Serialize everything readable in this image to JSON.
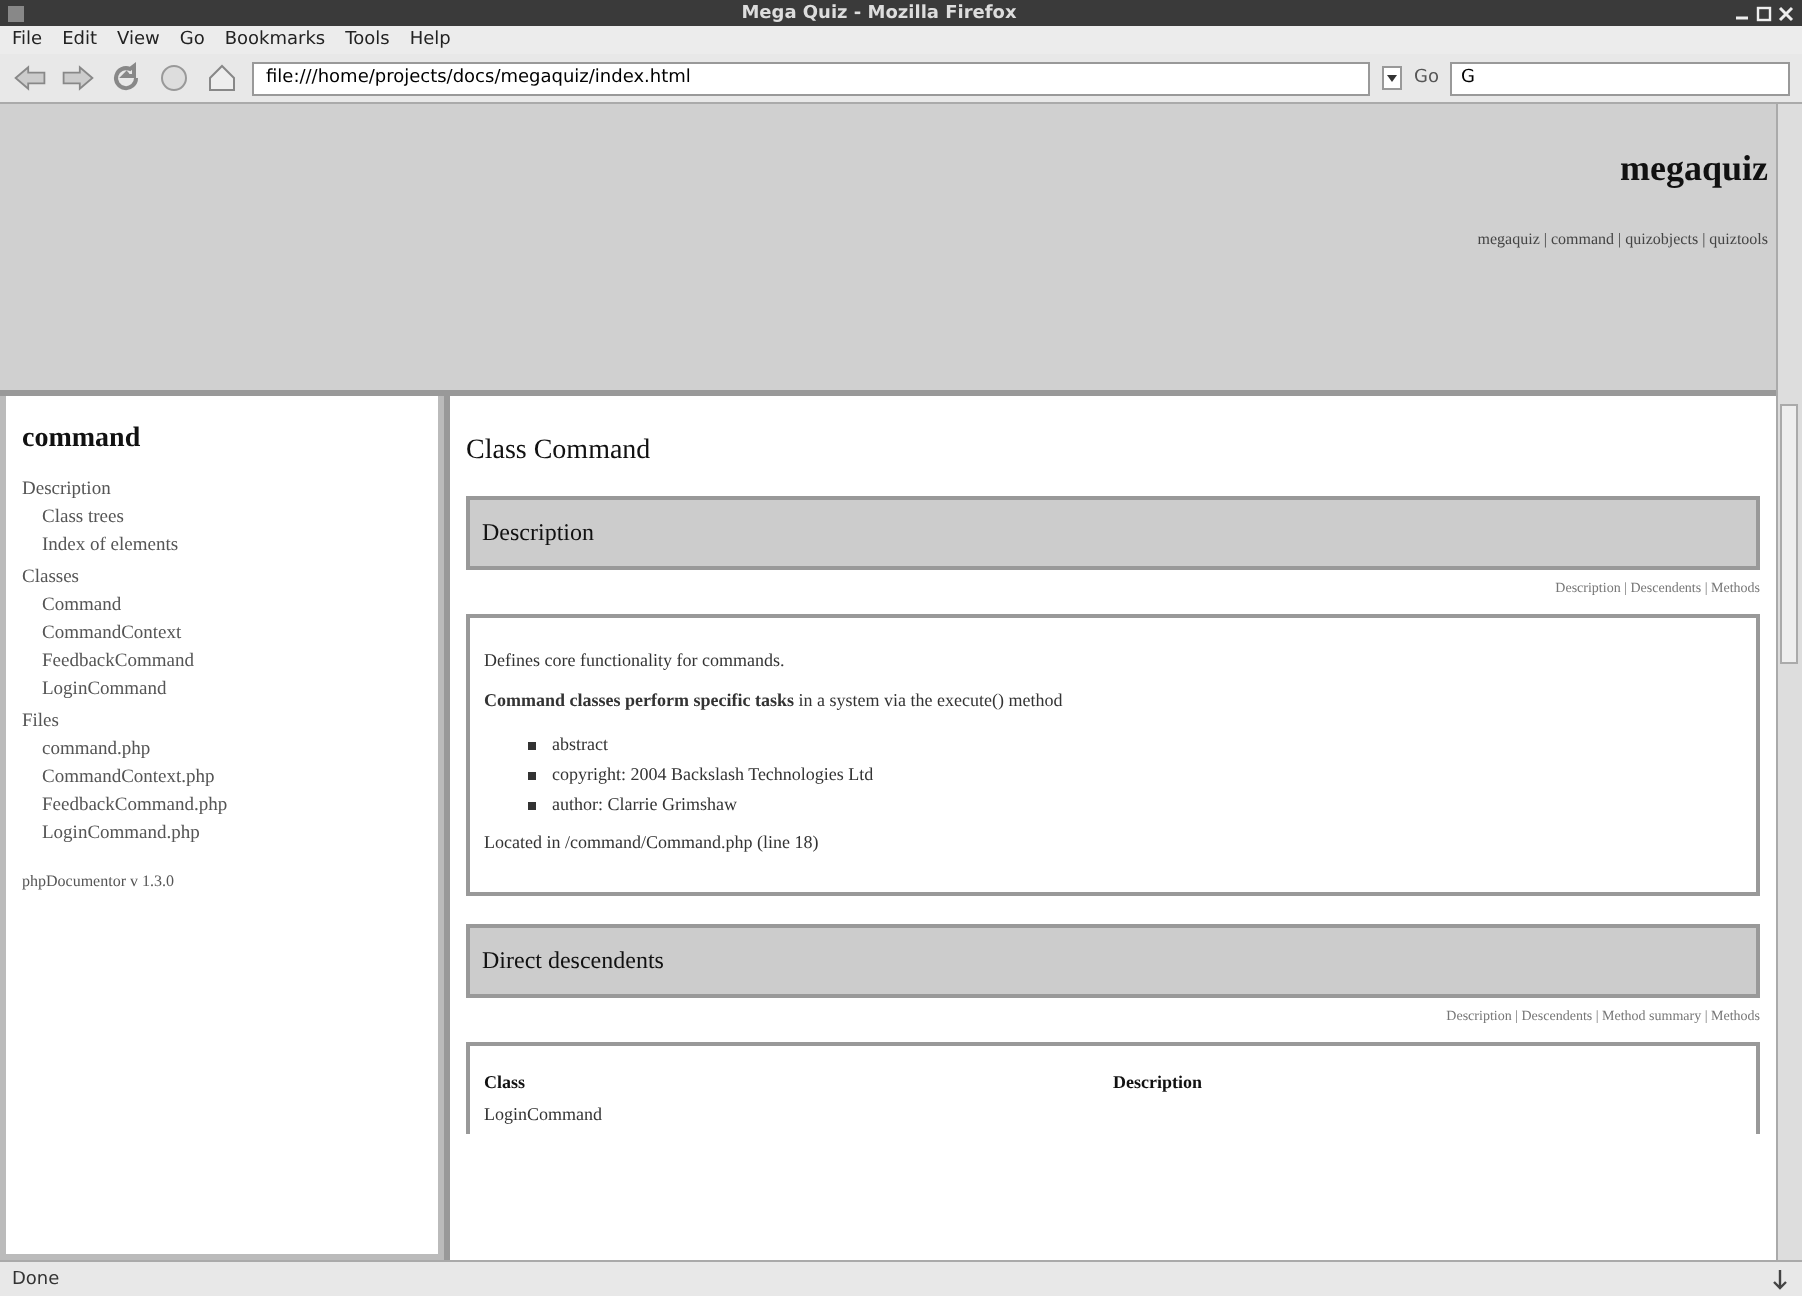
{
  "window": {
    "title": "Mega Quiz - Mozilla Firefox"
  },
  "menu": [
    "File",
    "Edit",
    "View",
    "Go",
    "Bookmarks",
    "Tools",
    "Help"
  ],
  "toolbar": {
    "url": "file:///home/projects/docs/megaquiz/index.html",
    "go": "Go",
    "search_value": "G"
  },
  "header": {
    "title": "megaquiz",
    "links": "megaquiz | command | quizobjects | quiztools"
  },
  "sidebar": {
    "title": "command",
    "sections": [
      {
        "label": "Description",
        "children": [
          {
            "label": "Class trees"
          },
          {
            "label": "Index of elements"
          }
        ]
      },
      {
        "label": "Classes",
        "children": [
          {
            "label": "Command"
          },
          {
            "label": "CommandContext"
          },
          {
            "label": "FeedbackCommand"
          },
          {
            "label": "LoginCommand"
          }
        ]
      },
      {
        "label": "Files",
        "children": [
          {
            "label": "command.php"
          },
          {
            "label": "CommandContext.php"
          },
          {
            "label": "FeedbackCommand.php"
          },
          {
            "label": "LoginCommand.php"
          }
        ]
      }
    ],
    "footer": "phpDocumentor v 1.3.0"
  },
  "main": {
    "title": "Class Command",
    "description": {
      "heading": "Description",
      "nav": "Description | Descendents | Methods",
      "paragraphs": [
        "Defines core functionality for commands.",
        "**Command classes perform specific tasks** in a system via the execute() method"
      ],
      "tags": [
        "abstract",
        "copyright: 2004 Backslash Technologies Ltd",
        "author: Clarrie Grimshaw"
      ],
      "located": "Located in /command/Command.php (line 18)"
    },
    "descendents": {
      "heading": "Direct descendents",
      "nav": "Description | Descendents | Method summary | Methods",
      "columns": [
        "Class",
        "Description"
      ],
      "rows": [
        [
          "LoginCommand",
          ""
        ]
      ]
    }
  },
  "status_bar": "Done"
}
